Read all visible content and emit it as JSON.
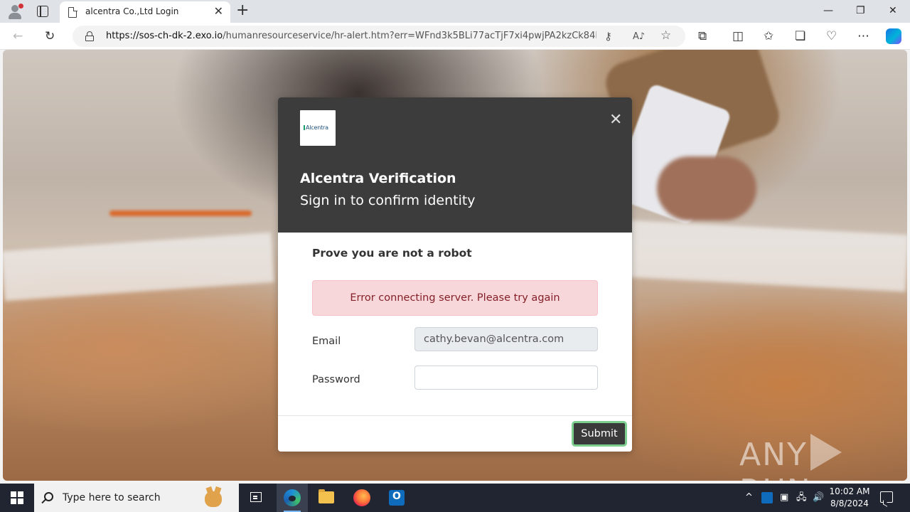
{
  "browser": {
    "tab_title": "alcentra Co.,Ltd Login",
    "tab_close": "✕",
    "new_tab": "+",
    "window_controls": {
      "minimize": "—",
      "maximize": "❐",
      "close": "✕"
    },
    "url_host": "https://sos-ch-dk-2.exo.io",
    "url_path": "/humanresourceservice/hr-alert.htm?err=WFnd3k5BLi77acTjF7xi4pwjPA2kzCk84IAFH...",
    "nav_icons": {
      "back": "←",
      "refresh": "↻"
    },
    "toolbar_icons": [
      "key-icon",
      "read-aloud-icon",
      "favorite-star-icon",
      "extensions-icon",
      "split-screen-icon",
      "favorites-icon",
      "collections-icon",
      "performance-icon",
      "more-icon",
      "copilot-icon"
    ]
  },
  "modal": {
    "logo_text": "Alcentra",
    "close": "✕",
    "title": "Alcentra Verification",
    "subtitle": "Sign in to confirm identity",
    "prompt": "Prove you are not a robot",
    "error": "Error connecting server. Please try again",
    "email_label": "Email",
    "email_value": "cathy.bevan@alcentra.com",
    "password_label": "Password",
    "password_value": "",
    "submit_label": "Submit"
  },
  "watermark": {
    "left": "ANY",
    "right": "RUN"
  },
  "taskbar": {
    "search_placeholder": "Type here to search",
    "apps": [
      "task-view-icon",
      "edge-icon",
      "file-explorer-icon",
      "firefox-icon",
      "outlook-icon"
    ],
    "outlook_letter": "O",
    "tray": {
      "chevron": "^",
      "speaker": "🔊"
    },
    "time": "10:02 AM",
    "date": "8/8/2024"
  },
  "colors": {
    "modal_header": "#3c3c3c",
    "alert_bg": "#f8d7da",
    "alert_text": "#842029",
    "submit_bg": "#3a3a3a",
    "submit_border": "#7ccf8f",
    "taskbar": "#202531"
  }
}
